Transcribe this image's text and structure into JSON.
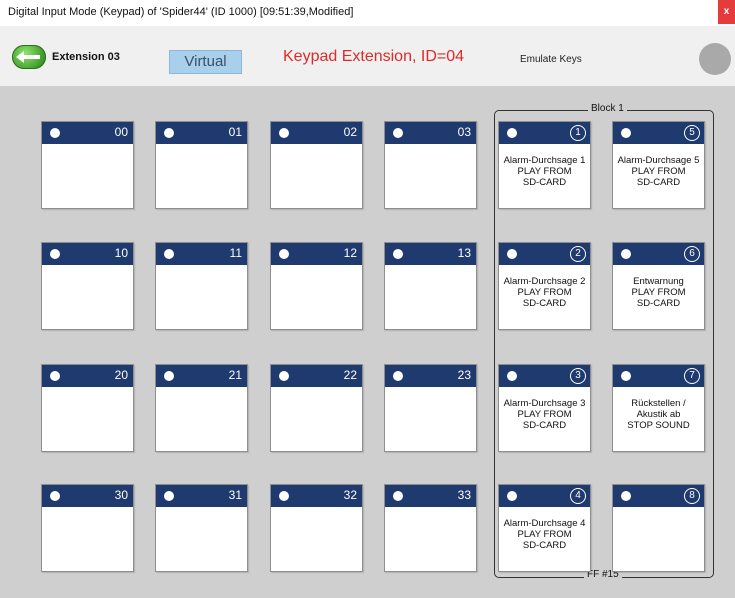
{
  "window": {
    "title": "Digital Input Mode (Keypad) of 'Spider44' (ID 1000)   [09:51:39,Modified]",
    "close_label": "x"
  },
  "header": {
    "extension_label": "Extension 03",
    "virtual_label": "Virtual",
    "keypad_title": "Keypad Extension, ID=04",
    "emulate_label": "Emulate Keys"
  },
  "block": {
    "label": "Block 1",
    "footer": "FF #15"
  },
  "keys": {
    "k00": {
      "num": "00"
    },
    "k01": {
      "num": "01"
    },
    "k02": {
      "num": "02"
    },
    "k03": {
      "num": "03"
    },
    "k10": {
      "num": "10"
    },
    "k11": {
      "num": "11"
    },
    "k12": {
      "num": "12"
    },
    "k13": {
      "num": "13"
    },
    "k20": {
      "num": "20"
    },
    "k21": {
      "num": "21"
    },
    "k22": {
      "num": "22"
    },
    "k23": {
      "num": "23"
    },
    "k30": {
      "num": "30"
    },
    "k31": {
      "num": "31"
    },
    "k32": {
      "num": "32"
    },
    "k33": {
      "num": "33"
    }
  },
  "block_keys": {
    "b1": {
      "num": "1",
      "line1": "Alarm-Durchsage 1",
      "line2": "PLAY FROM",
      "line3": "SD-CARD"
    },
    "b5": {
      "num": "5",
      "line1": "Alarm-Durchsage 5",
      "line2": "PLAY FROM",
      "line3": "SD-CARD"
    },
    "b2": {
      "num": "2",
      "line1": "Alarm-Durchsage 2",
      "line2": "PLAY FROM",
      "line3": "SD-CARD"
    },
    "b6": {
      "num": "6",
      "line1": "Entwarnung",
      "line2": "PLAY FROM",
      "line3": "SD-CARD"
    },
    "b3": {
      "num": "3",
      "line1": "Alarm-Durchsage 3",
      "line2": "PLAY FROM",
      "line3": "SD-CARD"
    },
    "b7": {
      "num": "7",
      "line1": "Rückstellen /",
      "line2": "Akustik ab",
      "line3": "STOP SOUND"
    },
    "b4": {
      "num": "4",
      "line1": "Alarm-Durchsage 4",
      "line2": "PLAY FROM",
      "line3": "SD-CARD"
    },
    "b8": {
      "num": "8",
      "line1": "",
      "line2": "",
      "line3": ""
    }
  },
  "colors": {
    "key_header": "#1f3a6e",
    "title_red": "#e02a2a",
    "virtual_bg": "#a8d0ec",
    "canvas_bg": "#cfcfcf"
  }
}
